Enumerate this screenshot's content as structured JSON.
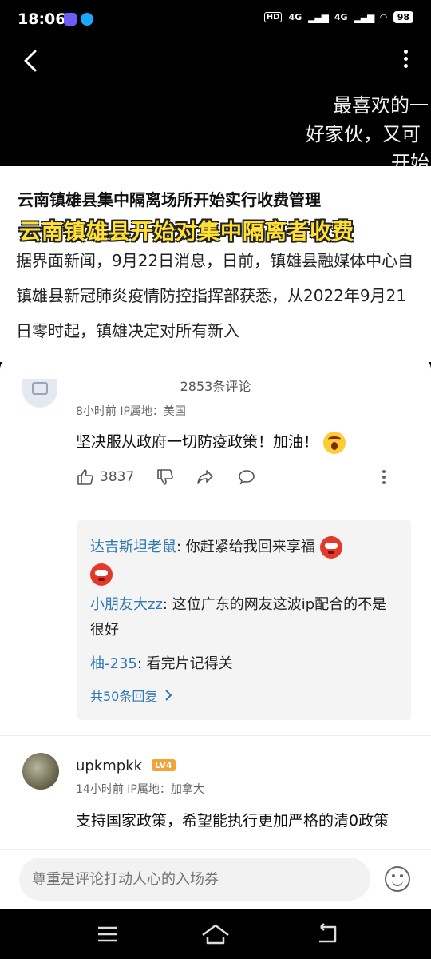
{
  "status_bar": {
    "time": "18:06",
    "hd_label": "HD",
    "net1": "4G",
    "net2": "4G",
    "battery": "98"
  },
  "video": {
    "subtitles": [
      "最喜欢的一",
      "好家伙，又可",
      "开始"
    ]
  },
  "article": {
    "title": "云南镇雄县集中隔离场所开始实行收费管理",
    "overlay_caption": "云南镇雄县开始对集中隔离者收费",
    "body": "据界面新闻，9月22日消息，日前，镇雄县融媒体中心自镇雄县新冠肺炎疫情防控指挥部获悉，从2022年9月21日零时起，镇雄决定对所有新入"
  },
  "comments_sheet": {
    "title": "2853条评论",
    "comment1": {
      "meta": "8小时前  IP属地：美国",
      "text": "坚决服从政府一切防疫政策！加油！",
      "like_count": "3837",
      "replies": [
        {
          "name": "达吉斯坦老鼠",
          "sep": ": ",
          "text": "你赶紧给我回来享福"
        },
        {
          "name": "小朋友大zz",
          "sep": ": ",
          "text": "这位广东的网友这波ip配合的不是很好"
        },
        {
          "name": "柚-235",
          "sep": ": ",
          "text": "看完片记得关"
        }
      ],
      "more_replies": "共50条回复"
    },
    "comment2": {
      "name": "upkmpkk",
      "level": "LV4",
      "meta": "14小时前  IP属地：加拿大",
      "text": "支持国家政策，希望能执行更加严格的清0政策"
    }
  },
  "input": {
    "placeholder": "尊重是评论打动人心的入场券"
  },
  "icons": {
    "back": "back-arrow-icon",
    "more": "more-vertical-icon",
    "like": "thumb-up-icon",
    "dislike": "thumb-down-icon",
    "share": "share-icon",
    "reply": "comment-bubble-icon",
    "emoji": "emoji-icon",
    "nav_menu": "menu-icon",
    "nav_home": "home-icon",
    "nav_back": "nav-back-icon"
  },
  "colors": {
    "link_blue": "#2f78b4",
    "caption_yellow": "#ffe033",
    "level_badge": "#f2a43a"
  }
}
